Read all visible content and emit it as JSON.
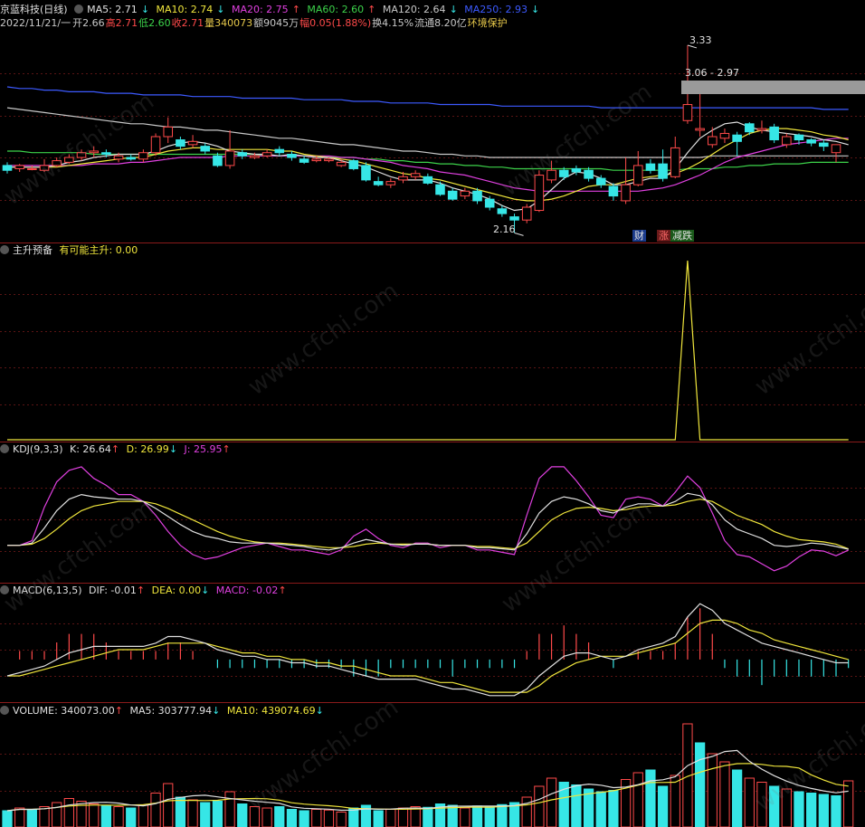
{
  "header": {
    "stock_name": "京蓝科技(日线)",
    "ma5": {
      "label": "MA5: 2.71",
      "arrow": "↓"
    },
    "ma10": {
      "label": "MA10: 2.74",
      "arrow": "↓"
    },
    "ma20": {
      "label": "MA20: 2.75",
      "arrow": "↑"
    },
    "ma60": {
      "label": "MA60: 2.60",
      "arrow": "↑"
    },
    "ma120": {
      "label": "MA120: 2.64",
      "arrow": "↓"
    },
    "ma250": {
      "label": "MA250: 2.93",
      "arrow": "↓"
    }
  },
  "info": {
    "date": "2022/11/21/一",
    "open": "开2.66",
    "high": "高2.71",
    "low": "低2.60",
    "close": "收2.71",
    "volume": "量340073",
    "amount": "额9045万",
    "change": "幅0.05(1.88%)",
    "turnover": "换4.15%",
    "float": "流通8.20亿",
    "tag": "环境保护"
  },
  "price_notes": {
    "high": "3.33",
    "range": "3.06 - 2.97",
    "low": "2.16"
  },
  "event_tags": {
    "cai": "财",
    "zhang": "涨",
    "jianchi": "减跌"
  },
  "panels": {
    "zsyb": {
      "name": "主升预备",
      "value": "有可能主升: 0.00"
    },
    "kdj": {
      "name": "KDJ(9,3,3)",
      "k": "K: 26.64",
      "k_arrow": "↑",
      "d": "D: 26.99",
      "d_arrow": "↓",
      "j": "J: 25.95",
      "j_arrow": "↑"
    },
    "macd": {
      "name": "MACD(6,13,5)",
      "dif": "DIF: -0.01",
      "dif_arrow": "↑",
      "dea": "DEA: 0.00",
      "dea_arrow": "↓",
      "macd": "MACD: -0.02",
      "macd_arrow": "↑"
    },
    "volume": {
      "name": "VOLUME: 340073.00",
      "name_arrow": "↑",
      "ma5": "MA5: 303777.94",
      "ma5_arrow": "↓",
      "ma10": "MA10: 439074.69",
      "ma10_arrow": "↓"
    }
  },
  "watermark": "www.cfchi.com",
  "colors": {
    "up": "#ff4a4a",
    "down": "#36e6e6",
    "ma5": "#e0e0e0",
    "ma10": "#f0e63c",
    "ma20": "#e040e0",
    "ma60": "#3cd24a",
    "ma250": "#3c5aff"
  },
  "chart_data": {
    "type": "candlestick",
    "candles": [
      {
        "o": 2.58,
        "c": 2.55,
        "h": 2.6,
        "l": 2.53
      },
      {
        "o": 2.56,
        "c": 2.58,
        "h": 2.59,
        "l": 2.54
      },
      {
        "o": 2.56,
        "c": 2.56,
        "h": 2.58,
        "l": 2.55
      },
      {
        "o": 2.55,
        "c": 2.58,
        "h": 2.62,
        "l": 2.54
      },
      {
        "o": 2.58,
        "c": 2.61,
        "h": 2.63,
        "l": 2.57
      },
      {
        "o": 2.6,
        "c": 2.63,
        "h": 2.65,
        "l": 2.59
      },
      {
        "o": 2.63,
        "c": 2.66,
        "h": 2.68,
        "l": 2.61
      },
      {
        "o": 2.66,
        "c": 2.67,
        "h": 2.7,
        "l": 2.63
      },
      {
        "o": 2.66,
        "c": 2.65,
        "h": 2.68,
        "l": 2.63
      },
      {
        "o": 2.62,
        "c": 2.64,
        "h": 2.66,
        "l": 2.6
      },
      {
        "o": 2.63,
        "c": 2.62,
        "h": 2.65,
        "l": 2.61
      },
      {
        "o": 2.62,
        "c": 2.66,
        "h": 2.68,
        "l": 2.6
      },
      {
        "o": 2.66,
        "c": 2.76,
        "h": 2.78,
        "l": 2.64
      },
      {
        "o": 2.76,
        "c": 2.82,
        "h": 2.88,
        "l": 2.72
      },
      {
        "o": 2.74,
        "c": 2.7,
        "h": 2.76,
        "l": 2.68
      },
      {
        "o": 2.71,
        "c": 2.73,
        "h": 2.77,
        "l": 2.69
      },
      {
        "o": 2.7,
        "c": 2.67,
        "h": 2.72,
        "l": 2.65
      },
      {
        "o": 2.64,
        "c": 2.58,
        "h": 2.66,
        "l": 2.57
      },
      {
        "o": 2.58,
        "c": 2.67,
        "h": 2.8,
        "l": 2.56
      },
      {
        "o": 2.66,
        "c": 2.64,
        "h": 2.68,
        "l": 2.62
      },
      {
        "o": 2.63,
        "c": 2.64,
        "h": 2.66,
        "l": 2.62
      },
      {
        "o": 2.64,
        "c": 2.66,
        "h": 2.68,
        "l": 2.63
      },
      {
        "o": 2.68,
        "c": 2.66,
        "h": 2.7,
        "l": 2.64
      },
      {
        "o": 2.65,
        "c": 2.63,
        "h": 2.67,
        "l": 2.61
      },
      {
        "o": 2.62,
        "c": 2.6,
        "h": 2.64,
        "l": 2.59
      },
      {
        "o": 2.61,
        "c": 2.62,
        "h": 2.64,
        "l": 2.6
      },
      {
        "o": 2.61,
        "c": 2.62,
        "h": 2.63,
        "l": 2.6
      },
      {
        "o": 2.58,
        "c": 2.6,
        "h": 2.62,
        "l": 2.57
      },
      {
        "o": 2.61,
        "c": 2.56,
        "h": 2.62,
        "l": 2.55
      },
      {
        "o": 2.58,
        "c": 2.49,
        "h": 2.6,
        "l": 2.48
      },
      {
        "o": 2.48,
        "c": 2.46,
        "h": 2.51,
        "l": 2.45
      },
      {
        "o": 2.46,
        "c": 2.48,
        "h": 2.5,
        "l": 2.44
      },
      {
        "o": 2.49,
        "c": 2.51,
        "h": 2.54,
        "l": 2.47
      },
      {
        "o": 2.51,
        "c": 2.53,
        "h": 2.55,
        "l": 2.49
      },
      {
        "o": 2.51,
        "c": 2.47,
        "h": 2.53,
        "l": 2.46
      },
      {
        "o": 2.46,
        "c": 2.4,
        "h": 2.48,
        "l": 2.39
      },
      {
        "o": 2.42,
        "c": 2.37,
        "h": 2.44,
        "l": 2.36
      },
      {
        "o": 2.39,
        "c": 2.42,
        "h": 2.44,
        "l": 2.37
      },
      {
        "o": 2.42,
        "c": 2.36,
        "h": 2.44,
        "l": 2.34
      },
      {
        "o": 2.37,
        "c": 2.32,
        "h": 2.39,
        "l": 2.3
      },
      {
        "o": 2.31,
        "c": 2.28,
        "h": 2.33,
        "l": 2.26
      },
      {
        "o": 2.26,
        "c": 2.24,
        "h": 2.28,
        "l": 2.16
      },
      {
        "o": 2.24,
        "c": 2.32,
        "h": 2.34,
        "l": 2.22
      },
      {
        "o": 2.3,
        "c": 2.52,
        "h": 2.55,
        "l": 2.29
      },
      {
        "o": 2.49,
        "c": 2.55,
        "h": 2.61,
        "l": 2.47
      },
      {
        "o": 2.55,
        "c": 2.51,
        "h": 2.57,
        "l": 2.49
      },
      {
        "o": 2.56,
        "c": 2.54,
        "h": 2.58,
        "l": 2.52
      },
      {
        "o": 2.55,
        "c": 2.5,
        "h": 2.57,
        "l": 2.48
      },
      {
        "o": 2.5,
        "c": 2.46,
        "h": 2.52,
        "l": 2.44
      },
      {
        "o": 2.45,
        "c": 2.39,
        "h": 2.47,
        "l": 2.36
      },
      {
        "o": 2.36,
        "c": 2.46,
        "h": 2.63,
        "l": 2.34
      },
      {
        "o": 2.46,
        "c": 2.58,
        "h": 2.67,
        "l": 2.45
      },
      {
        "o": 2.59,
        "c": 2.55,
        "h": 2.62,
        "l": 2.53
      },
      {
        "o": 2.59,
        "c": 2.5,
        "h": 2.68,
        "l": 2.48
      },
      {
        "o": 2.51,
        "c": 2.69,
        "h": 2.76,
        "l": 2.5
      },
      {
        "o": 2.86,
        "c": 2.96,
        "h": 3.33,
        "l": 2.84
      },
      {
        "o": 2.8,
        "c": 2.81,
        "h": 3.06,
        "l": 2.76
      },
      {
        "o": 2.71,
        "c": 2.76,
        "h": 2.82,
        "l": 2.69
      },
      {
        "o": 2.75,
        "c": 2.78,
        "h": 2.81,
        "l": 2.72
      },
      {
        "o": 2.77,
        "c": 2.73,
        "h": 2.79,
        "l": 2.64
      },
      {
        "o": 2.84,
        "c": 2.79,
        "h": 2.85,
        "l": 2.77
      },
      {
        "o": 2.8,
        "c": 2.81,
        "h": 2.86,
        "l": 2.78
      },
      {
        "o": 2.82,
        "c": 2.74,
        "h": 2.84,
        "l": 2.72
      },
      {
        "o": 2.71,
        "c": 2.76,
        "h": 2.78,
        "l": 2.69
      },
      {
        "o": 2.77,
        "c": 2.74,
        "h": 2.78,
        "l": 2.71
      },
      {
        "o": 2.74,
        "c": 2.72,
        "h": 2.75,
        "l": 2.7
      },
      {
        "o": 2.72,
        "c": 2.7,
        "h": 2.74,
        "l": 2.67
      },
      {
        "o": 2.66,
        "c": 2.71,
        "h": 2.71,
        "l": 2.6
      }
    ],
    "ma5": [
      2.57,
      2.57,
      2.57,
      2.57,
      2.58,
      2.6,
      2.61,
      2.63,
      2.64,
      2.65,
      2.65,
      2.65,
      2.67,
      2.7,
      2.72,
      2.73,
      2.72,
      2.7,
      2.67,
      2.66,
      2.65,
      2.65,
      2.64,
      2.65,
      2.64,
      2.63,
      2.63,
      2.61,
      2.59,
      2.57,
      2.54,
      2.51,
      2.49,
      2.49,
      2.49,
      2.47,
      2.44,
      2.42,
      2.4,
      2.37,
      2.33,
      2.3,
      2.31,
      2.36,
      2.43,
      2.5,
      2.54,
      2.53,
      2.5,
      2.46,
      2.46,
      2.48,
      2.5,
      2.5,
      2.56,
      2.66,
      2.75,
      2.8,
      2.84,
      2.85,
      2.82,
      2.8,
      2.79,
      2.78,
      2.77,
      2.76,
      2.74,
      2.73,
      2.71
    ],
    "ma10": [
      2.57,
      2.57,
      2.57,
      2.57,
      2.57,
      2.58,
      2.59,
      2.6,
      2.61,
      2.62,
      2.63,
      2.63,
      2.65,
      2.67,
      2.68,
      2.69,
      2.69,
      2.68,
      2.68,
      2.68,
      2.68,
      2.68,
      2.67,
      2.67,
      2.65,
      2.64,
      2.63,
      2.62,
      2.61,
      2.59,
      2.57,
      2.55,
      2.53,
      2.52,
      2.5,
      2.49,
      2.47,
      2.45,
      2.43,
      2.41,
      2.39,
      2.37,
      2.36,
      2.36,
      2.37,
      2.39,
      2.42,
      2.45,
      2.46,
      2.46,
      2.48,
      2.5,
      2.51,
      2.52,
      2.53,
      2.56,
      2.6,
      2.65,
      2.7,
      2.74,
      2.78,
      2.8,
      2.81,
      2.81,
      2.8,
      2.79,
      2.77,
      2.76,
      2.74
    ],
    "ma20": [
      2.58,
      2.58,
      2.58,
      2.58,
      2.58,
      2.58,
      2.58,
      2.59,
      2.59,
      2.59,
      2.6,
      2.6,
      2.61,
      2.62,
      2.63,
      2.63,
      2.63,
      2.63,
      2.64,
      2.64,
      2.64,
      2.64,
      2.64,
      2.64,
      2.64,
      2.64,
      2.64,
      2.63,
      2.63,
      2.62,
      2.61,
      2.6,
      2.58,
      2.57,
      2.56,
      2.54,
      2.53,
      2.52,
      2.5,
      2.48,
      2.46,
      2.44,
      2.43,
      2.42,
      2.42,
      2.42,
      2.42,
      2.42,
      2.42,
      2.42,
      2.42,
      2.42,
      2.43,
      2.44,
      2.46,
      2.49,
      2.52,
      2.56,
      2.6,
      2.63,
      2.65,
      2.67,
      2.69,
      2.71,
      2.72,
      2.73,
      2.74,
      2.75,
      2.75
    ],
    "ma60": [
      2.67,
      2.67,
      2.66,
      2.66,
      2.66,
      2.66,
      2.66,
      2.65,
      2.65,
      2.65,
      2.65,
      2.65,
      2.65,
      2.65,
      2.65,
      2.65,
      2.65,
      2.65,
      2.65,
      2.65,
      2.65,
      2.64,
      2.64,
      2.64,
      2.64,
      2.64,
      2.63,
      2.63,
      2.63,
      2.62,
      2.62,
      2.61,
      2.61,
      2.6,
      2.6,
      2.59,
      2.59,
      2.58,
      2.58,
      2.57,
      2.57,
      2.56,
      2.56,
      2.56,
      2.56,
      2.56,
      2.56,
      2.56,
      2.56,
      2.55,
      2.55,
      2.55,
      2.55,
      2.55,
      2.55,
      2.56,
      2.56,
      2.56,
      2.57,
      2.57,
      2.58,
      2.58,
      2.59,
      2.59,
      2.59,
      2.6,
      2.6,
      2.6,
      2.6
    ],
    "ma120": [
      2.94,
      2.93,
      2.92,
      2.91,
      2.9,
      2.89,
      2.88,
      2.87,
      2.86,
      2.85,
      2.84,
      2.84,
      2.83,
      2.82,
      2.82,
      2.81,
      2.8,
      2.8,
      2.79,
      2.78,
      2.77,
      2.76,
      2.75,
      2.75,
      2.74,
      2.73,
      2.72,
      2.71,
      2.71,
      2.7,
      2.69,
      2.68,
      2.67,
      2.67,
      2.66,
      2.65,
      2.65,
      2.64,
      2.64,
      2.63,
      2.63,
      2.63,
      2.63,
      2.63,
      2.63,
      2.63,
      2.63,
      2.63,
      2.63,
      2.63,
      2.63,
      2.63,
      2.63,
      2.63,
      2.63,
      2.63,
      2.63,
      2.64,
      2.64,
      2.64,
      2.64,
      2.64,
      2.64,
      2.64,
      2.64,
      2.64,
      2.64,
      2.64,
      2.64
    ],
    "ma250": [
      3.07,
      3.06,
      3.06,
      3.05,
      3.05,
      3.04,
      3.04,
      3.04,
      3.03,
      3.03,
      3.03,
      3.02,
      3.02,
      3.02,
      3.02,
      3.01,
      3.01,
      3.01,
      3.01,
      3.0,
      3.0,
      3.0,
      3.0,
      3.0,
      2.99,
      2.99,
      2.99,
      2.99,
      2.98,
      2.98,
      2.98,
      2.97,
      2.97,
      2.97,
      2.97,
      2.96,
      2.96,
      2.96,
      2.96,
      2.96,
      2.95,
      2.95,
      2.95,
      2.95,
      2.95,
      2.95,
      2.95,
      2.95,
      2.94,
      2.94,
      2.94,
      2.94,
      2.94,
      2.94,
      2.94,
      2.94,
      2.94,
      2.94,
      2.94,
      2.94,
      2.94,
      2.94,
      2.94,
      2.94,
      2.94,
      2.94,
      2.93,
      2.93,
      2.93
    ],
    "zsyb": [
      0,
      0,
      0,
      0,
      0,
      0,
      0,
      0,
      0,
      0,
      0,
      0,
      0,
      0,
      0,
      0,
      0,
      0,
      0,
      0,
      0,
      0,
      0,
      0,
      0,
      0,
      0,
      0,
      0,
      0,
      0,
      0,
      0,
      0,
      0,
      0,
      0,
      0,
      0,
      0,
      0,
      0,
      0,
      0,
      0,
      0,
      0,
      0,
      0,
      0,
      0,
      0,
      0,
      0,
      0,
      1,
      0,
      0,
      0,
      0,
      0,
      0,
      0,
      0,
      0,
      0,
      0,
      0,
      0
    ],
    "kdj_k": [
      30,
      30,
      32,
      45,
      60,
      70,
      74,
      72,
      71,
      70,
      70,
      68,
      62,
      55,
      48,
      42,
      38,
      36,
      33,
      32,
      32,
      32,
      31,
      30,
      29,
      27,
      26,
      28,
      32,
      35,
      33,
      31,
      30,
      31,
      31,
      30,
      30,
      30,
      28,
      28,
      27,
      26,
      40,
      58,
      68,
      72,
      70,
      66,
      60,
      58,
      63,
      66,
      66,
      64,
      68,
      75,
      73,
      65,
      52,
      44,
      40,
      36,
      30,
      29,
      30,
      32,
      31,
      29,
      26.64
    ],
    "kdj_d": [
      30,
      30,
      31,
      36,
      44,
      53,
      60,
      64,
      66,
      68,
      68,
      68,
      66,
      62,
      57,
      52,
      47,
      42,
      38,
      35,
      33,
      32,
      32,
      31,
      30,
      29,
      28,
      28,
      29,
      31,
      32,
      31,
      31,
      31,
      31,
      30,
      30,
      30,
      29,
      29,
      28,
      27,
      32,
      42,
      52,
      58,
      62,
      63,
      62,
      60,
      61,
      63,
      64,
      64,
      65,
      68,
      70,
      68,
      62,
      56,
      52,
      48,
      42,
      38,
      35,
      34,
      33,
      31,
      26.99
    ],
    "kdj_j": [
      30,
      30,
      34,
      63,
      85,
      95,
      98,
      88,
      82,
      74,
      74,
      68,
      56,
      42,
      30,
      22,
      18,
      20,
      24,
      28,
      30,
      32,
      29,
      26,
      26,
      24,
      22,
      26,
      38,
      44,
      36,
      30,
      28,
      32,
      32,
      28,
      30,
      30,
      26,
      26,
      24,
      22,
      56,
      88,
      98,
      98,
      86,
      72,
      56,
      54,
      70,
      72,
      70,
      64,
      76,
      90,
      80,
      58,
      34,
      22,
      20,
      14,
      8,
      12,
      20,
      26,
      25,
      21,
      25.95
    ],
    "macd_dif": [
      -0.05,
      -0.04,
      -0.03,
      -0.02,
      0.0,
      0.02,
      0.03,
      0.04,
      0.04,
      0.04,
      0.04,
      0.04,
      0.05,
      0.07,
      0.07,
      0.06,
      0.05,
      0.03,
      0.02,
      0.01,
      0.01,
      0.0,
      0.0,
      -0.01,
      -0.01,
      -0.02,
      -0.02,
      -0.03,
      -0.04,
      -0.05,
      -0.06,
      -0.06,
      -0.06,
      -0.06,
      -0.07,
      -0.08,
      -0.09,
      -0.09,
      -0.1,
      -0.11,
      -0.11,
      -0.11,
      -0.09,
      -0.05,
      -0.02,
      0.01,
      0.02,
      0.02,
      0.01,
      0.0,
      0.01,
      0.03,
      0.04,
      0.05,
      0.07,
      0.13,
      0.17,
      0.15,
      0.11,
      0.09,
      0.07,
      0.05,
      0.04,
      0.03,
      0.02,
      0.01,
      0.0,
      -0.01,
      -0.01
    ],
    "macd_dea": [
      -0.05,
      -0.05,
      -0.04,
      -0.03,
      -0.02,
      -0.01,
      0.0,
      0.01,
      0.02,
      0.03,
      0.03,
      0.03,
      0.04,
      0.05,
      0.05,
      0.05,
      0.05,
      0.04,
      0.03,
      0.02,
      0.02,
      0.01,
      0.01,
      0.0,
      0.0,
      -0.01,
      -0.01,
      -0.02,
      -0.02,
      -0.03,
      -0.04,
      -0.05,
      -0.05,
      -0.05,
      -0.06,
      -0.07,
      -0.07,
      -0.08,
      -0.09,
      -0.1,
      -0.1,
      -0.1,
      -0.1,
      -0.08,
      -0.05,
      -0.03,
      -0.01,
      0.0,
      0.01,
      0.01,
      0.01,
      0.02,
      0.03,
      0.04,
      0.05,
      0.08,
      0.11,
      0.12,
      0.12,
      0.11,
      0.09,
      0.08,
      0.06,
      0.05,
      0.04,
      0.03,
      0.02,
      0.01,
      0.0
    ],
    "volume": [
      120,
      140,
      130,
      150,
      180,
      210,
      190,
      170,
      160,
      150,
      140,
      160,
      250,
      320,
      220,
      200,
      180,
      190,
      260,
      170,
      150,
      140,
      150,
      130,
      120,
      130,
      125,
      110,
      140,
      160,
      120,
      130,
      140,
      150,
      145,
      170,
      160,
      140,
      155,
      150,
      165,
      180,
      220,
      300,
      360,
      330,
      310,
      280,
      260,
      270,
      350,
      400,
      420,
      300,
      380,
      760,
      620,
      540,
      480,
      420,
      360,
      330,
      300,
      280,
      260,
      250,
      240,
      230,
      340
    ],
    "vol_up": [
      false,
      true,
      false,
      true,
      true,
      true,
      true,
      true,
      false,
      true,
      false,
      true,
      true,
      true,
      false,
      true,
      false,
      false,
      true,
      false,
      true,
      true,
      false,
      false,
      false,
      true,
      true,
      true,
      false,
      false,
      false,
      true,
      true,
      true,
      false,
      false,
      false,
      true,
      false,
      false,
      false,
      false,
      true,
      true,
      true,
      false,
      false,
      false,
      false,
      false,
      true,
      true,
      false,
      false,
      true,
      true,
      false,
      true,
      true,
      false,
      true,
      true,
      false,
      true,
      false,
      false,
      false,
      false,
      true
    ]
  }
}
